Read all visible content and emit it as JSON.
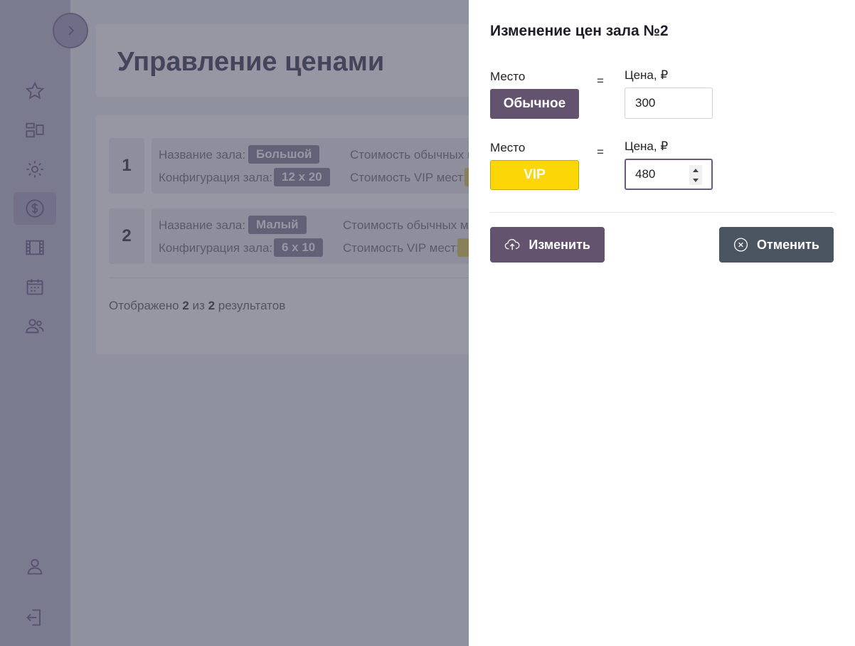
{
  "page": {
    "title": "Управление ценами"
  },
  "sidebar": {
    "items": [
      {
        "icon": "star-icon"
      },
      {
        "icon": "layout-icon"
      },
      {
        "icon": "gear-icon"
      },
      {
        "icon": "dollar-icon",
        "active": true
      },
      {
        "icon": "film-icon"
      },
      {
        "icon": "calendar-icon"
      },
      {
        "icon": "users-icon"
      }
    ],
    "bottom": [
      {
        "icon": "user-icon"
      },
      {
        "icon": "logout-icon"
      }
    ]
  },
  "halls": [
    {
      "number": "1",
      "name_label": "Название зала:",
      "name": "Большой",
      "config_label": "Конфигурация зала:",
      "config": "12 x 20",
      "normal_label": "Стоимость обычных мест:",
      "vip_label": "Стоимость VIP мест:"
    },
    {
      "number": "2",
      "name_label": "Название зала:",
      "name": "Малый",
      "config_label": "Конфигурация зала:",
      "config": "6 x 10",
      "normal_label": "Стоимость обычных мест:",
      "vip_label": "Стоимость VIP мест:"
    }
  ],
  "summary": {
    "prefix": "Отображено",
    "shown": "2",
    "middle": "из",
    "total": "2",
    "suffix": "результатов"
  },
  "drawer": {
    "title": "Изменение цен зала №2",
    "rows": [
      {
        "seat_label": "Место",
        "seat_type": "Обычное",
        "equals": "=",
        "price_label": "Цена, ₽",
        "price": "300"
      },
      {
        "seat_label": "Место",
        "seat_type": "VIP",
        "equals": "=",
        "price_label": "Цена, ₽",
        "price": "480"
      }
    ],
    "save_label": "Изменить",
    "cancel_label": "Отменить"
  },
  "colors": {
    "accent": "#64536f",
    "vip": "#fdd608",
    "cancel": "#4b5562"
  }
}
